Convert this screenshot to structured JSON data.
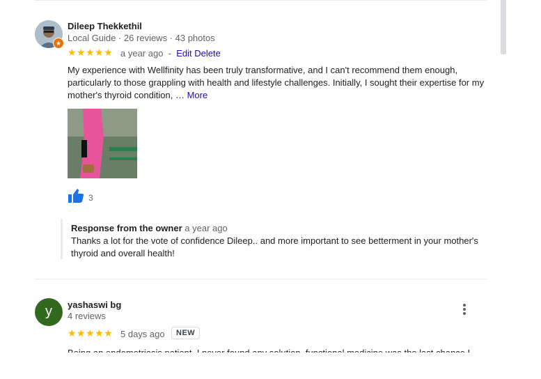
{
  "review1": {
    "reviewer_name": "Dileep Thekkethil",
    "reviewer_meta": "Local Guide · 26 reviews · 43 photos",
    "rating": 5,
    "stars_text": "★★★★★",
    "time": "a year ago",
    "separator": "-",
    "edit_label": "Edit",
    "delete_label": "Delete",
    "text": "My experience with Wellfinity has been truly transformative, and I can't recommend them enough, particularly to those grappling with health and lifestyle challenges. Initially, I sought their expertise for my mother's thyroid condition, …",
    "more_label": "More",
    "like_count": "3",
    "owner_response": {
      "title": "Response from the owner",
      "time": "a year ago",
      "text": "Thanks a lot for the vote of confidence Dileep.. and more important to see betterment in your mother's thyroid and overall health!"
    }
  },
  "review2": {
    "avatar_letter": "y",
    "reviewer_name": "yashaswi bg",
    "reviewer_meta": "4 reviews",
    "rating": 5,
    "stars_text": "★★★★★",
    "time": "5 days ago",
    "badge": "NEW",
    "text_partial": "Being an endometriosis patient, I never found any solution, functional medicine was the last chance I"
  },
  "colors": {
    "star": "#fbbc04",
    "link": "#1a0dab",
    "like": "#1a73e8",
    "avatar_green": "#33691e",
    "guide_badge": "#e8710a"
  }
}
